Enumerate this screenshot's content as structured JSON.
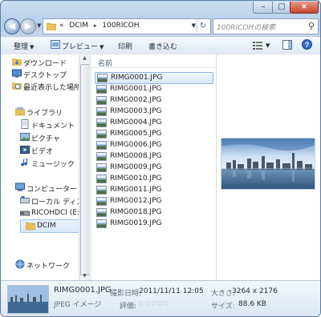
{
  "address": {
    "crumbs": [
      "«",
      "DCIM",
      "▸",
      "100RICOH"
    ]
  },
  "search": {
    "placeholder": "100RICOHの検索"
  },
  "toolbar": {
    "organize": "整理",
    "preview": "プレビュー",
    "print": "印刷",
    "burn": "書き込む"
  },
  "nav": {
    "favorites": [
      "ダウンロード",
      "デスクトップ",
      "最近表示した場所"
    ],
    "libraries_label": "ライブラリ",
    "libraries": [
      "ドキュメント",
      "ピクチャ",
      "ビデオ",
      "ミュージック"
    ],
    "computer_label": "コンピューター",
    "drives": [
      "ローカル ディスク",
      "RICOHDCI (E:)"
    ],
    "current_folder": "DCIM",
    "network_label": "ネットワーク"
  },
  "filelist": {
    "column_header": "名前",
    "selected": "RIMG0001.JPG",
    "files": [
      "RIMG0001.JPG",
      "RIMG0002.JPG",
      "RIMG0003.JPG",
      "RIMG0004.JPG",
      "RIMG0005.JPG",
      "RIMG0006.JPG",
      "RIMG0008.JPG",
      "RIMG0009.JPG",
      "RIMG0010.JPG",
      "RIMG0011.JPG",
      "RIMG0012.JPG",
      "RIMG0018.JPG",
      "RIMG0019.JPG"
    ]
  },
  "details": {
    "filename": "RIMG0001.JPG",
    "filetype": "JPEG イメージ",
    "date_label": "撮影日時:",
    "date_value": "2011/11/11 12:05",
    "rating_label": "評価:",
    "rating_stars": 0,
    "size_label": "大きさ:",
    "size_value": "3264 x 2176",
    "filesize_label": "サイズ:",
    "filesize_value": "88.6 KB"
  },
  "colors": {
    "selection": "#d6e8fb",
    "accent": "#3a6ba8"
  }
}
